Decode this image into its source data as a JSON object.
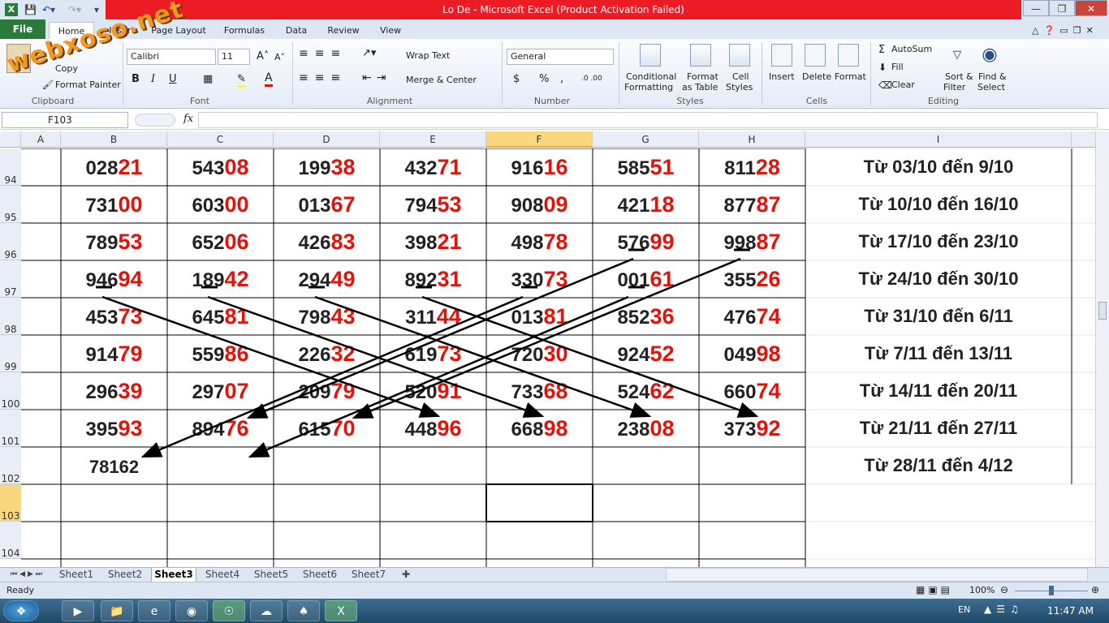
{
  "window": {
    "title": "Lo De  -  Microsoft Excel (Product Activation Failed)"
  },
  "watermark": "webxoso.net",
  "ribbon_tabs": [
    "File",
    "Home",
    "Insert",
    "Page Layout",
    "Formulas",
    "Data",
    "Review",
    "View"
  ],
  "clipboard": {
    "copy": "Copy",
    "format_painter": "Format Painter",
    "label": "Clipboard"
  },
  "font": {
    "name": "Calibri",
    "size": "11",
    "label": "Font",
    "bold": "B",
    "italic": "I",
    "underline": "U"
  },
  "alignment": {
    "wrap": "Wrap Text",
    "merge": "Merge & Center",
    "label": "Alignment"
  },
  "number": {
    "format": "General",
    "currency": "$",
    "percent": "%",
    "comma": ",",
    "label": "Number"
  },
  "styles": {
    "conditional": "Conditional",
    "conditional2": "Formatting",
    "format_table": "Format",
    "format_table2": "as Table",
    "cell_styles": "Cell",
    "cell_styles2": "Styles",
    "label": "Styles"
  },
  "cells": {
    "insert": "Insert",
    "delete": "Delete",
    "format": "Format",
    "label": "Cells"
  },
  "editing": {
    "autosum": "AutoSum",
    "fill": "Fill",
    "clear": "Clear",
    "sort": "Sort &",
    "sort2": "Filter",
    "find": "Find &",
    "find2": "Select",
    "label": "Editing"
  },
  "namebox": "F103",
  "fx": "fx",
  "columns": [
    "A",
    "B",
    "C",
    "D",
    "E",
    "F",
    "G",
    "H",
    "I"
  ],
  "rows": [
    "94",
    "95",
    "96",
    "97",
    "98",
    "99",
    "100",
    "101",
    "102",
    "103",
    "104"
  ],
  "table": [
    [
      [
        "028",
        "21"
      ],
      [
        "543",
        "08"
      ],
      [
        "199",
        "38"
      ],
      [
        "432",
        "71"
      ],
      [
        "916",
        "16"
      ],
      [
        "585",
        "51"
      ],
      [
        "811",
        "28"
      ]
    ],
    [
      [
        "731",
        "00"
      ],
      [
        "603",
        "00"
      ],
      [
        "013",
        "67"
      ],
      [
        "794",
        "53"
      ],
      [
        "908",
        "09"
      ],
      [
        "421",
        "18"
      ],
      [
        "877",
        "87"
      ]
    ],
    [
      [
        "789",
        "53"
      ],
      [
        "652",
        "06"
      ],
      [
        "426",
        "83"
      ],
      [
        "398",
        "21"
      ],
      [
        "498",
        "78"
      ],
      [
        "576",
        "99"
      ],
      [
        "998",
        "87"
      ]
    ],
    [
      [
        "946",
        "94"
      ],
      [
        "189",
        "42"
      ],
      [
        "294",
        "49"
      ],
      [
        "892",
        "31"
      ],
      [
        "330",
        "73"
      ],
      [
        "001",
        "61"
      ],
      [
        "355",
        "26"
      ]
    ],
    [
      [
        "453",
        "73"
      ],
      [
        "645",
        "81"
      ],
      [
        "798",
        "43"
      ],
      [
        "311",
        "44"
      ],
      [
        "013",
        "81"
      ],
      [
        "852",
        "36"
      ],
      [
        "476",
        "74"
      ]
    ],
    [
      [
        "914",
        "79"
      ],
      [
        "559",
        "86"
      ],
      [
        "226",
        "32"
      ],
      [
        "619",
        "73"
      ],
      [
        "720",
        "30"
      ],
      [
        "924",
        "52"
      ],
      [
        "049",
        "98"
      ]
    ],
    [
      [
        "296",
        "39"
      ],
      [
        "297",
        "07"
      ],
      [
        "209",
        "79"
      ],
      [
        "520",
        "91"
      ],
      [
        "733",
        "68"
      ],
      [
        "524",
        "62"
      ],
      [
        "660",
        "74"
      ]
    ],
    [
      [
        "395",
        "93"
      ],
      [
        "894",
        "76"
      ],
      [
        "615",
        "70"
      ],
      [
        "448",
        "96"
      ],
      [
        "668",
        "98"
      ],
      [
        "238",
        "08"
      ],
      [
        "373",
        "92"
      ]
    ]
  ],
  "extra_cell": "78162",
  "ranges": [
    "Từ 03/10 đến 9/10",
    "Từ 10/10 đến 16/10",
    "Từ 17/10 đến 23/10",
    "Từ 24/10 đến 30/10",
    "Từ 31/10 đến 6/11",
    "Từ 7/11 đến 13/11",
    "Từ 14/11 đến 20/11",
    "Từ 21/11 đến 27/11",
    "Từ 28/11 đến 4/12"
  ],
  "sheets": [
    "Sheet1",
    "Sheet2",
    "Sheet3",
    "Sheet4",
    "Sheet5",
    "Sheet6",
    "Sheet7"
  ],
  "active_sheet": "Sheet3",
  "status": {
    "ready": "Ready",
    "zoom": "100%"
  },
  "taskbar": {
    "lang": "EN",
    "time": "11:47 AM"
  },
  "colors": {
    "accent_red": "#e3120b",
    "title_red": "#ec1c24",
    "file_green": "#2a7a3c"
  }
}
